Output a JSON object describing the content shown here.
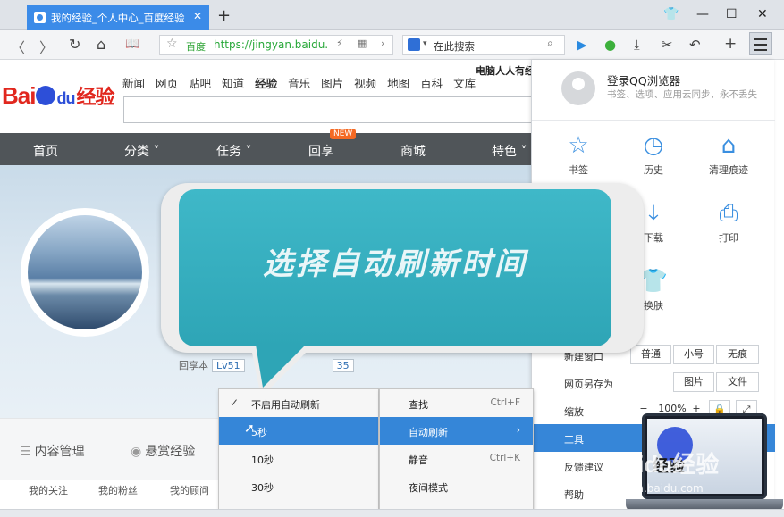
{
  "browser": {
    "tab_title": "我的经验_个人中心_百度经验",
    "tab_close": "✕",
    "new_tab": "+",
    "window": {
      "skin": "👕",
      "minimize": "—",
      "maximize": "☐",
      "close": "✕"
    },
    "nav": {
      "back": "〈",
      "forward": "〉",
      "refresh": "↻",
      "home": "⌂",
      "reader": "📖"
    },
    "address": {
      "star": "☆",
      "source": "百度",
      "url_host": "https://jingyan.baidu.",
      "url_rest": ""
    },
    "search_placeholder": "在此搜索",
    "toolbar_icons": {
      "video": "▶",
      "chat": "●",
      "download": "⤓",
      "scissors": "✂",
      "undo": "↶",
      "add": "+"
    }
  },
  "page": {
    "top_links": [
      "新闻",
      "网页",
      "贴吧",
      "知道",
      "经验",
      "音乐",
      "图片",
      "视频",
      "地图",
      "百科",
      "文库"
    ],
    "active_link": "经验",
    "tagline": "电脑人人有经",
    "logo": {
      "text_left": "Bai",
      "text_mid": "du",
      "text_right": "经验"
    },
    "nav_items": [
      "首页",
      "分类 ˅",
      "任务 ˅",
      "回享",
      "商城",
      "特色 ˅"
    ],
    "new_badge": "NEW",
    "level_label": "回享本",
    "level_badges": [
      "Lv51",
      "35"
    ],
    "sub_tabs": [
      "内容管理",
      "悬赏经验"
    ],
    "bottom_links": [
      "我的关注",
      "我的粉丝",
      "我的顾问"
    ]
  },
  "bubble": {
    "text": "选择自动刷新时间"
  },
  "menu_panel": {
    "login_title": "登录QQ浏览器",
    "login_sub": "书签、选项、应用云同步，永不丢失",
    "grid": [
      {
        "label": "书签",
        "icon": "☆"
      },
      {
        "label": "历史",
        "icon": "◷"
      },
      {
        "label": "清理痕迹",
        "icon": "⌂"
      },
      {
        "label": "下载",
        "icon": "⤓"
      },
      {
        "label": "打印",
        "icon": "⎙"
      },
      {
        "label": "换肤",
        "icon": "👕"
      }
    ],
    "rows": [
      {
        "label": "新建窗口",
        "buttons": [
          "普通",
          "小号",
          "无痕"
        ]
      },
      {
        "label": "网页另存为",
        "buttons": [
          "图片",
          "文件"
        ]
      },
      {
        "label": "缩放",
        "buttons": [
          "−",
          "100%",
          "+",
          "🔒",
          "⤢"
        ]
      },
      {
        "label": "工具",
        "buttons": []
      },
      {
        "label": "反馈建议",
        "buttons": []
      },
      {
        "label": "帮助",
        "buttons": []
      }
    ]
  },
  "refresh_submenu": {
    "check": "✓",
    "items": [
      "不启用自动刷新",
      "5秒",
      "10秒",
      "30秒"
    ],
    "highlighted_index": 1
  },
  "tools_menu": {
    "items": [
      {
        "label": "查找",
        "shortcut": "Ctrl+F"
      },
      {
        "label": "自动刷新",
        "shortcut": "›"
      },
      {
        "label": "静音",
        "shortcut": "Ctrl+K"
      },
      {
        "label": "夜间模式",
        "shortcut": ""
      }
    ],
    "highlighted_index": 1
  },
  "watermark": {
    "logo": "Baidu经验",
    "screen_text": "经验",
    "url": "jingyan.baidu.com"
  },
  "colors": {
    "accent": "#3686d8",
    "baidu_red": "#e1271e",
    "baidu_blue": "#2d4fd8",
    "bubble": "#2ea5b6",
    "nav_dark": "#505559"
  }
}
